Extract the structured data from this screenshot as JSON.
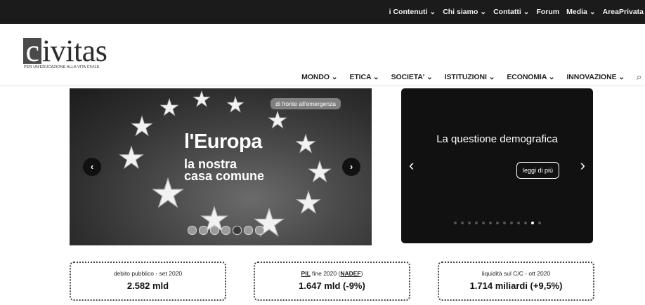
{
  "top_menu": [
    "i Contenuti ⌄",
    "Chi siamo ⌄",
    "Contatti ⌄",
    "Forum",
    "Media ⌄",
    "AreaPrivata"
  ],
  "logo": {
    "word_first": "c",
    "word_rest": "ivitas",
    "tagline": "PER UN'EDUCAZIONE ALLA VITA CIVILE"
  },
  "main_nav": [
    "MONDO ⌄",
    "ETICA ⌄",
    "SOCIETA' ⌄",
    "ISTITUZIONI ⌄",
    "ECONOMIA ⌄",
    "INNOVAZIONE ⌄"
  ],
  "search_icon": "⌕",
  "slider_left": {
    "badge": "di fronte all'emergenza",
    "title": "l'Europa",
    "subtitle_line1": "la nostra",
    "subtitle_line2": "casa comune",
    "prev": "‹",
    "next": "›",
    "dots_total": 7,
    "dot_active": 4
  },
  "slider_right": {
    "title": "La questione demografica",
    "button": "leggi di più",
    "prev": "‹",
    "next": "›",
    "dots_total": 13,
    "dot_active": 11
  },
  "stats": [
    {
      "label": "debito pubblico - set 2020",
      "value": "2.582 mld"
    },
    {
      "label_link1": "PIL",
      "label_mid": " fine 2020 (",
      "label_link2": "NADEF",
      "label_end": ")",
      "value": "1.647 mld (-9%)"
    },
    {
      "label": "liquidità sul C/C - ott 2020",
      "value": "1.714 miliardi (+9,5%)"
    }
  ],
  "colors": {
    "topbar": "#1b1b1b",
    "dark_slide": "#111111"
  }
}
